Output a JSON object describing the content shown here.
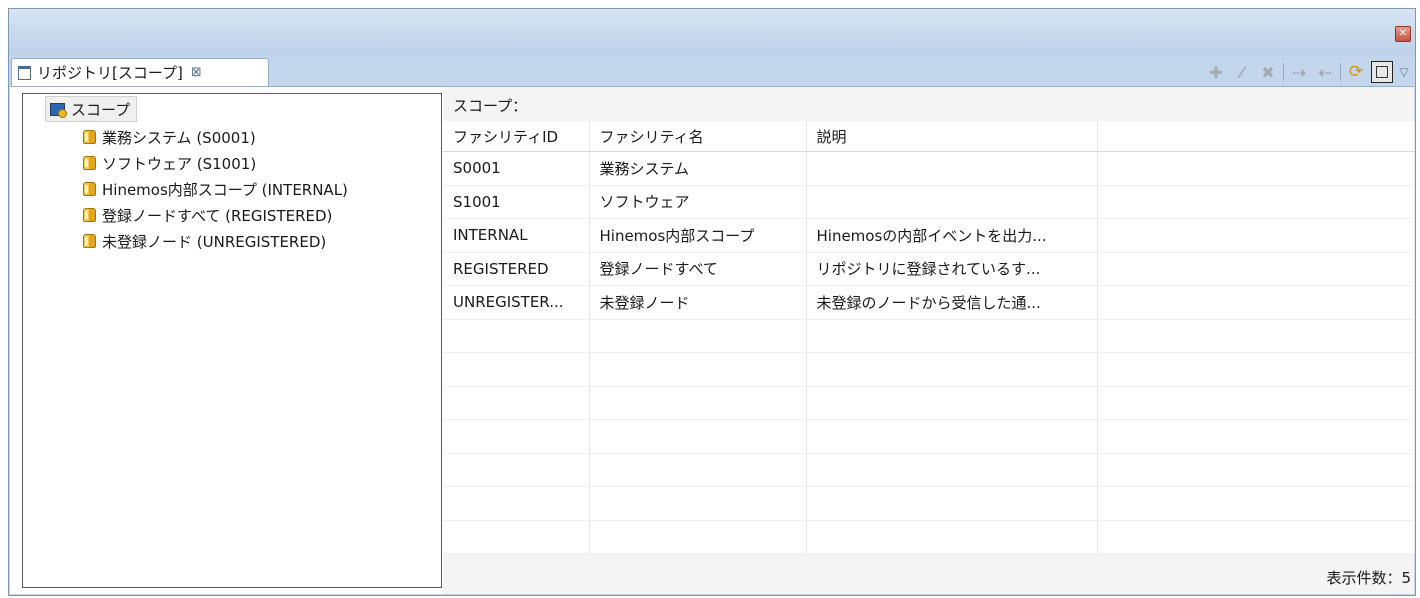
{
  "window": {
    "close_icon": "close-icon"
  },
  "tab": {
    "title": "リポジトリ[スコープ]",
    "close_glyph": "⊠"
  },
  "toolbar": {
    "add_glyph": "✚",
    "edit_glyph": "⁄",
    "delete_glyph": "✖",
    "assign_glyph": "⇢",
    "release_glyph": "⇠",
    "refresh_glyph": "⟳",
    "menu_glyph": "▽"
  },
  "tree": {
    "root": {
      "label": "スコープ"
    },
    "items": [
      {
        "label": "業務システム (S0001)"
      },
      {
        "label": "ソフトウェア (S1001)"
      },
      {
        "label": "Hinemos内部スコープ (INTERNAL)"
      },
      {
        "label": "登録ノードすべて (REGISTERED)"
      },
      {
        "label": "未登録ノード (UNREGISTERED)"
      }
    ]
  },
  "details": {
    "scope_label": "スコープ：",
    "columns": [
      "ファシリティID",
      "ファシリティ名",
      "説明"
    ],
    "rows": [
      [
        "S0001",
        "業務システム",
        ""
      ],
      [
        "S1001",
        "ソフトウェア",
        ""
      ],
      [
        "INTERNAL",
        "Hinemos内部スコープ",
        "Hinemosの内部イベントを出力..."
      ],
      [
        "REGISTERED",
        "登録ノードすべて",
        "リポジトリに登録されているす..."
      ],
      [
        "UNREGISTER...",
        "未登録ノード",
        "未登録のノードから受信した通..."
      ]
    ],
    "count_label": "表示件数：5"
  },
  "colors": {
    "frame": "#c4d6ec",
    "border": "#7f97b5",
    "scope_icon": "#e6a51c",
    "root_icon": "#2c66b0"
  }
}
